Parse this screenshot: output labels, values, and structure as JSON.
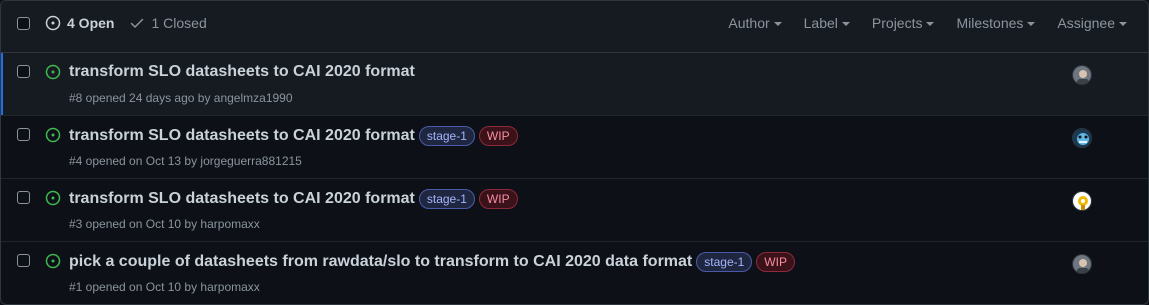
{
  "header": {
    "open_label": "4 Open",
    "closed_label": "1 Closed",
    "filters": [
      "Author",
      "Label",
      "Projects",
      "Milestones",
      "Assignee"
    ]
  },
  "issues": [
    {
      "title": "transform SLO datasheets to CAI 2020 format",
      "meta": "#8 opened 24 days ago by angelmza1990",
      "labels": [],
      "avatar": "avatar-gray-person",
      "selected": true
    },
    {
      "title": "transform SLO datasheets to CAI 2020 format",
      "meta": "#4 opened on Oct 13 by jorgeguerra881215",
      "labels": [
        "stage-1",
        "WIP"
      ],
      "avatar": "avatar-blue-pattern"
    },
    {
      "title": "transform SLO datasheets to CAI 2020 format",
      "meta": "#3 opened on Oct 10 by harpomaxx",
      "labels": [
        "stage-1",
        "WIP"
      ],
      "avatar": "avatar-yellow-character"
    },
    {
      "title": "pick a couple of datasheets from rawdata/slo to transform to CAI 2020 data format",
      "meta": "#1 opened on Oct 10 by harpomaxx",
      "labels": [
        "stage-1",
        "WIP"
      ],
      "avatar": "avatar-gray-person"
    }
  ],
  "colors": {
    "background": "#0d1117",
    "header_bg": "#161b22",
    "open_green": "#3fb950",
    "accent_blue": "#1f6feb",
    "muted": "#8b949e"
  }
}
